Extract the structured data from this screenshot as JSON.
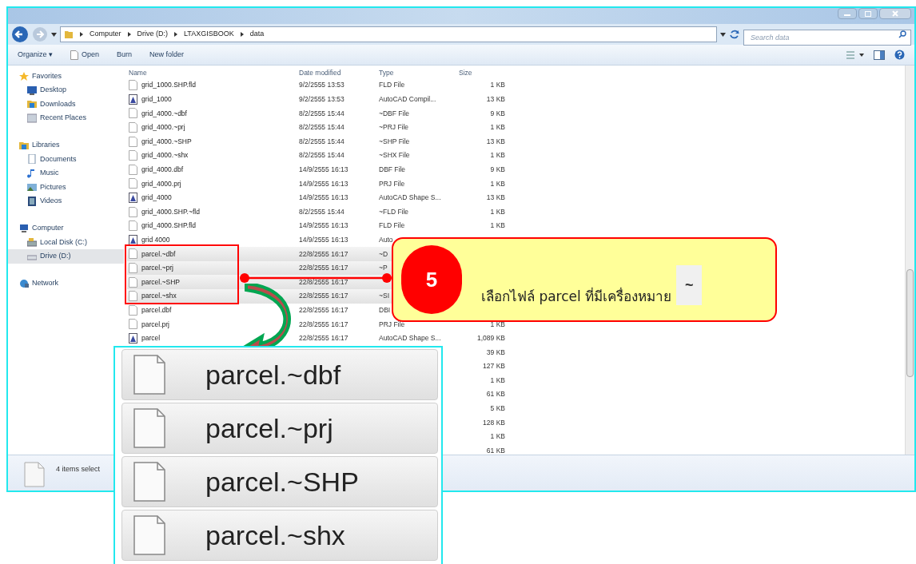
{
  "address_bar": {
    "path": [
      "Computer",
      "Drive (D:)",
      "LTAXGISBOOK",
      "data"
    ],
    "search_placeholder": "Search data"
  },
  "toolbar": {
    "items": [
      "Organize ▾",
      "Open",
      "Burn",
      "New folder"
    ]
  },
  "sidebar": {
    "groups": [
      {
        "label": "Favorites",
        "items": [
          {
            "label": "Desktop",
            "selected": false
          },
          {
            "label": "Downloads",
            "selected": false
          },
          {
            "label": "Recent Places",
            "selected": false
          }
        ]
      },
      {
        "label": "Libraries",
        "items": [
          {
            "label": "Documents",
            "selected": false
          },
          {
            "label": "Music",
            "selected": false
          },
          {
            "label": "Pictures",
            "selected": false
          },
          {
            "label": "Videos",
            "selected": false
          }
        ]
      },
      {
        "label": "Computer",
        "items": [
          {
            "label": "Local Disk (C:)",
            "selected": false
          },
          {
            "label": "Drive (D:)",
            "selected": true
          }
        ]
      },
      {
        "label": "Network"
      }
    ]
  },
  "file_list": {
    "columns": [
      "Name",
      "Date modified",
      "Type",
      "Size"
    ],
    "rows": [
      {
        "name": "grid_1000.SHP.fld",
        "date": "9/2/2555 13:53",
        "type": "FLD File",
        "size": "1 KB",
        "kind": "blank",
        "selected": false
      },
      {
        "name": "grid_1000",
        "date": "9/2/2555 13:53",
        "type": "AutoCAD Compil...",
        "size": "13 KB",
        "kind": "cad",
        "selected": false
      },
      {
        "name": "grid_4000.~dbf",
        "date": "8/2/2555 15:44",
        "type": "~DBF File",
        "size": "9 KB",
        "kind": "blank",
        "selected": false
      },
      {
        "name": "grid_4000.~prj",
        "date": "8/2/2555 15:44",
        "type": "~PRJ File",
        "size": "1 KB",
        "kind": "blank",
        "selected": false
      },
      {
        "name": "grid_4000.~SHP",
        "date": "8/2/2555 15:44",
        "type": "~SHP File",
        "size": "13 KB",
        "kind": "blank",
        "selected": false
      },
      {
        "name": "grid_4000.~shx",
        "date": "8/2/2555 15:44",
        "type": "~SHX File",
        "size": "1 KB",
        "kind": "blank",
        "selected": false
      },
      {
        "name": "grid_4000.dbf",
        "date": "14/9/2555 16:13",
        "type": "DBF File",
        "size": "9 KB",
        "kind": "blank",
        "selected": false
      },
      {
        "name": "grid_4000.prj",
        "date": "14/9/2555 16:13",
        "type": "PRJ File",
        "size": "1 KB",
        "kind": "blank",
        "selected": false
      },
      {
        "name": "grid_4000",
        "date": "14/9/2555 16:13",
        "type": "AutoCAD Shape S...",
        "size": "13 KB",
        "kind": "cad",
        "selected": false
      },
      {
        "name": "grid_4000.SHP.~fld",
        "date": "8/2/2555 15:44",
        "type": "~FLD File",
        "size": "1 KB",
        "kind": "blank",
        "selected": false
      },
      {
        "name": "grid_4000.SHP.fld",
        "date": "14/9/2555 16:13",
        "type": "FLD File",
        "size": "1 KB",
        "kind": "blank",
        "selected": false
      },
      {
        "name": "grid 4000",
        "date": "14/9/2555 16:13",
        "type": "Auto",
        "kind": "cad",
        "selected": false
      },
      {
        "name": "parcel.~dbf",
        "date": "22/8/2555 16:17",
        "type": "~D",
        "kind": "blank",
        "selected": true
      },
      {
        "name": "parcel.~prj",
        "date": "22/8/2555 16:17",
        "type": "~P",
        "kind": "blank",
        "selected": true
      },
      {
        "name": "parcel.~SHP",
        "date": "22/8/2555 16:17",
        "kind": "blank",
        "selected": true
      },
      {
        "name": "parcel.~shx",
        "date": "22/8/2555 16:17",
        "type": "~SI",
        "kind": "blank",
        "selected": true
      },
      {
        "name": "parcel.dbf",
        "date": "22/8/2555 16:17",
        "type": "DBI",
        "kind": "blank",
        "selected": false
      },
      {
        "name": "parcel.prj",
        "date": "22/8/2555 16:17",
        "type": "PRJ File",
        "size": "1 KB",
        "kind": "blank",
        "selected": false
      },
      {
        "name": "parcel",
        "date": "22/8/2555 16:17",
        "type": "AutoCAD Shape S...",
        "size": "1,089 KB",
        "kind": "cad",
        "selected": false
      },
      {
        "size": "39 KB",
        "kind": "hidden",
        "selected": false
      },
      {
        "size": "127 KB",
        "kind": "hidden",
        "selected": false
      },
      {
        "size": "1 KB",
        "kind": "hidden",
        "selected": false
      },
      {
        "size": "61 KB",
        "kind": "hidden",
        "selected": false
      },
      {
        "size": "5 KB",
        "kind": "hidden",
        "selected": false
      },
      {
        "size": "128 KB",
        "kind": "hidden",
        "selected": false
      },
      {
        "size": "1 KB",
        "kind": "hidden",
        "selected": false
      },
      {
        "size": "61 KB",
        "kind": "hidden",
        "selected": false
      }
    ]
  },
  "status_bar": {
    "text": "4 items select"
  },
  "callout": {
    "number": "5",
    "text": "เลือกไฟล์ parcel ที่มีเครื่องหมาย",
    "symbol": "~"
  },
  "magnifier": {
    "items": [
      "parcel.~dbf",
      "parcel.~prj",
      "parcel.~SHP",
      "parcel.~shx"
    ]
  }
}
